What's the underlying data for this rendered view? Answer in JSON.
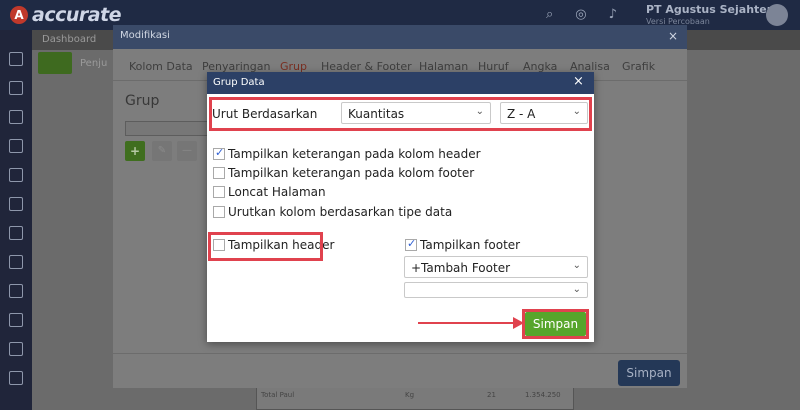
{
  "app": {
    "logo_text": "accurate",
    "company_name": "PT Agustus Sejahtera",
    "company_sub": "Versi Percobaan",
    "tab_label": "Dashboard",
    "page_label": "Penju"
  },
  "modif": {
    "title": "Modifikasi",
    "close": "×",
    "tabs": [
      "Kolom Data",
      "Penyaringan",
      "Grup",
      "Header & Footer",
      "Halaman",
      "Huruf",
      "Angka",
      "Analisa",
      "Grafik"
    ],
    "active_tab": "Grup",
    "section_title": "Grup",
    "save_label": "Simpan"
  },
  "dialog": {
    "title": "Grup Data",
    "close": "×",
    "sort_label": "Urut Berdasarkan",
    "sort_by_value": "Kuantitas",
    "sort_order_value": "Z - A",
    "options": [
      {
        "label": "Tampilkan keterangan pada kolom header",
        "checked": true
      },
      {
        "label": "Tampilkan keterangan pada kolom footer",
        "checked": false
      },
      {
        "label": "Loncat Halaman",
        "checked": false
      },
      {
        "label": "Urutkan kolom berdasarkan tipe data",
        "checked": false
      }
    ],
    "show_header_label": "Tampilkan header",
    "show_header_checked": false,
    "show_footer_label": "Tampilkan footer",
    "show_footer_checked": true,
    "add_footer_value": "+Tambah Footer",
    "empty_select_value": "",
    "save_label": "Simpan"
  },
  "bg_table": {
    "label": "Total Paul",
    "col2": "Kg",
    "col3": "21",
    "col4": "1.354.250"
  },
  "colors": {
    "highlight": "#e0424e",
    "save_green": "#57a52b",
    "dialog_header": "#2c4066",
    "check_blue": "#2f5fd3"
  },
  "icons": {
    "chevron": "chevron-down-icon",
    "check": "check-icon",
    "close": "close-icon"
  }
}
